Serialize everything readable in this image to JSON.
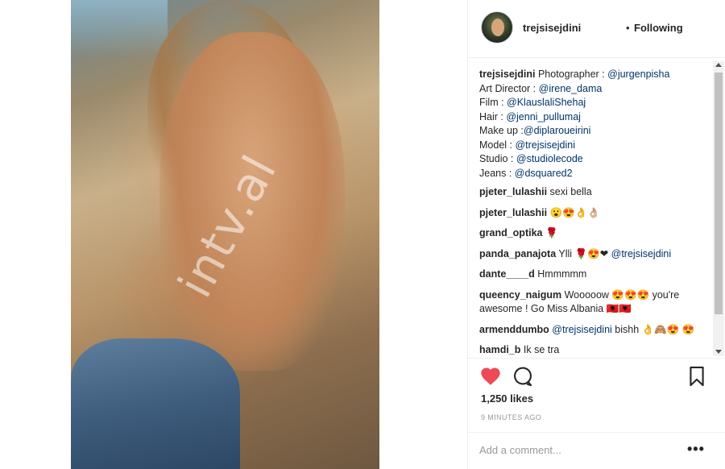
{
  "post": {
    "username": "trejsisejdini",
    "separator": "•",
    "follow_status": "Following",
    "watermark": "intv.al"
  },
  "caption": {
    "author": "trejsisejdini",
    "lines": [
      {
        "text": " Photographer : ",
        "mention": "@jurgenpisha"
      },
      {
        "text": "Art Director : ",
        "mention": "@irene_dama"
      },
      {
        "text": "Film : ",
        "mention": "@KlauslaliShehaj"
      },
      {
        "text": "Hair : ",
        "mention": "@jenni_pullumaj"
      },
      {
        "text": "Make up :",
        "mention": "@diplaroueirini"
      },
      {
        "text": "Model : ",
        "mention": "@trejsisejdini"
      },
      {
        "text": "Studio : ",
        "mention": "@studiolecode"
      },
      {
        "text": "Jeans : ",
        "mention": "@dsquared2"
      }
    ]
  },
  "comments": [
    {
      "user": "pjeter_lulashii",
      "text": " sexi bella"
    },
    {
      "user": "pjeter_lulashii",
      "text": " 😮😍👌👌🏼"
    },
    {
      "user": "grand_optika",
      "text": " 🌹"
    },
    {
      "user": "panda_panajota",
      "text": " Ylli 🌹😍❤ ",
      "mention": "@trejsisejdini"
    },
    {
      "user": "dante____d",
      "text": " Hmmmmm"
    },
    {
      "user": "queency_naigum",
      "text": " Wooooow 😍😍😍 you're awesome ! Go Miss Albania 🇦🇱🇦🇱"
    },
    {
      "user": "armenddumbo",
      "text": " bishh 👌🙈😍 😍",
      "mention_before": " @trejsisejdini"
    },
    {
      "user": "hamdi_b",
      "text": " Ik se tra"
    }
  ],
  "actions": {
    "likes": "1,250 likes",
    "time": "9 MINUTES AGO",
    "add_comment_placeholder": "Add a comment...",
    "more": "•••"
  },
  "colors": {
    "like": "#ed4956",
    "mention": "#003569",
    "text": "#262626",
    "muted": "#999999"
  },
  "icons": {
    "like": "heart-icon",
    "comment": "speech-bubble-icon",
    "save": "bookmark-icon",
    "more": "ellipsis-icon"
  }
}
